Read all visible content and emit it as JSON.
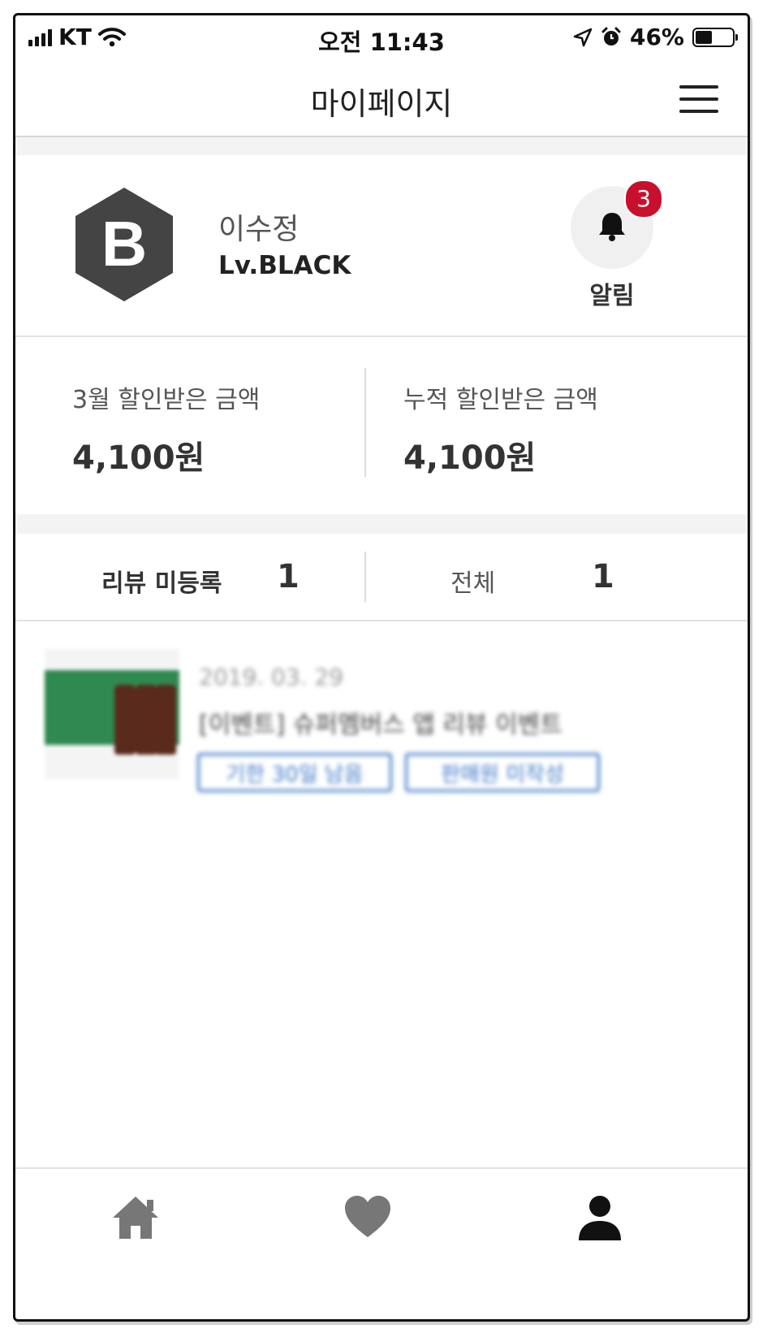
{
  "status_bar": {
    "carrier": "KT",
    "time": "오전 11:43",
    "battery": "46%",
    "battery_level": 0.46
  },
  "header": {
    "title": "마이페이지"
  },
  "profile": {
    "level_badge_letter": "B",
    "name": "이수정",
    "level": "Lv.BLACK",
    "notification_count": "3",
    "notification_label": "알림"
  },
  "stats": {
    "monthly": {
      "label": "3월 할인받은 금액",
      "value": "4,100원"
    },
    "total": {
      "label": "누적 할인받은 금액",
      "value": "4,100원"
    }
  },
  "review_tabs": {
    "unregistered": {
      "label": "리뷰 미등록",
      "count": "1"
    },
    "all": {
      "label": "전체",
      "count": "1"
    }
  },
  "review_item": {
    "date": "2019. 03. 29",
    "title": "[이벤트] 슈퍼멤버스 앱 리뷰 이벤트",
    "button1": "기한 30일 남음",
    "button2": "판매원 미작성"
  },
  "colors": {
    "badge": "#c8102e",
    "hex_badge": "#444444",
    "button_outline": "#3d78c7"
  },
  "bottom_nav": [
    "home-icon",
    "heart-icon",
    "person-icon"
  ]
}
